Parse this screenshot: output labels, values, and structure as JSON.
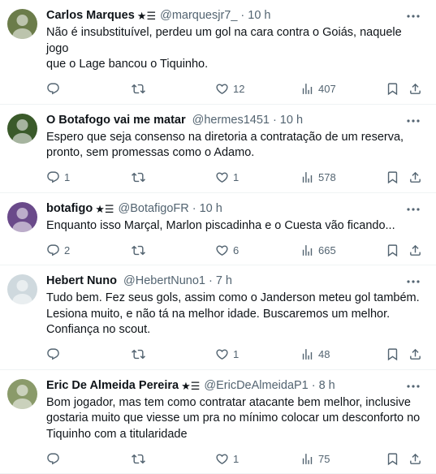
{
  "tweets": [
    {
      "name": "Carlos Marques",
      "badge": "★☰",
      "handle": "@marquesjr7_",
      "time": "10 h",
      "text": "Não é insubstituível, perdeu um gol na cara contra o Goiás, naquele jogo\nque o Lage bancou o Tiquinho.",
      "replies": "",
      "retweets": "",
      "likes": "12",
      "views": "407",
      "avatar_color": "#6b7c4a"
    },
    {
      "name": "O Botafogo vai me matar",
      "badge": "",
      "handle": "@hermes1451",
      "time": "10 h",
      "text": "Espero que seja consenso na diretoria a contratação de um reserva,\npronto, sem promessas como o Adamo.",
      "replies": "1",
      "retweets": "",
      "likes": "1",
      "views": "578",
      "avatar_color": "#3a5a2a"
    },
    {
      "name": "botafigo",
      "badge": "★☰",
      "handle": "@BotafigoFR",
      "time": "10 h",
      "text": "Enquanto isso Marçal, Marlon piscadinha e o Cuesta vão ficando...",
      "replies": "2",
      "retweets": "",
      "likes": "6",
      "views": "665",
      "avatar_color": "#6a4a8a"
    },
    {
      "name": "Hebert Nuno",
      "badge": "",
      "handle": "@HebertNuno1",
      "time": "7 h",
      "text": "Tudo bem. Fez seus gols, assim como o Janderson meteu gol também.\nLesiona muito, e não tá na melhor idade. Buscaremos um melhor.\nConfiança no scout.",
      "replies": "",
      "retweets": "",
      "likes": "1",
      "views": "48",
      "avatar_color": "#cfd9de"
    },
    {
      "name": "Eric De Almeida Pereira",
      "badge": "★☰",
      "handle": "@EricDeAlmeidaP1",
      "time": "8 h",
      "text": "Bom jogador, mas tem como contratar atacante bem melhor, inclusive\ngostaria muito que viesse um pra no mínimo colocar um desconforto no\nTiquinho com a titularidade",
      "replies": "",
      "retweets": "",
      "likes": "1",
      "views": "75",
      "avatar_color": "#8a9a6a"
    }
  ],
  "separator": "·",
  "icons": {
    "reply": "reply-icon",
    "retweet": "retweet-icon",
    "like": "like-icon",
    "views": "views-icon",
    "bookmark": "bookmark-icon",
    "share": "share-icon",
    "more": "more-icon"
  },
  "colors": {
    "text": "#0f1419",
    "muted": "#536471",
    "divider": "#eff3f4"
  }
}
